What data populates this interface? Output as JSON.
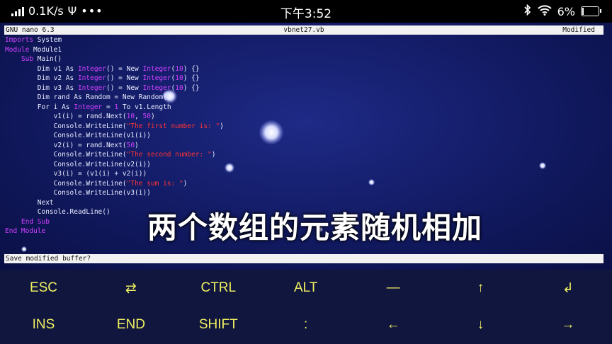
{
  "status_bar": {
    "speed": "0.1K/s",
    "time": "下午3:52",
    "battery": "6%",
    "battery_level": 0.06
  },
  "editor": {
    "app_version": "GNU nano 6.3",
    "filename": "vbnet27.vb",
    "state": "Modified",
    "prompt": "Save modified buffer?"
  },
  "code_lines": [
    [
      {
        "t": "Imports",
        "c": "kw"
      },
      {
        "t": " System",
        "c": "plain"
      }
    ],
    [
      {
        "t": "Module",
        "c": "kw"
      },
      {
        "t": " Module1",
        "c": "plain"
      }
    ],
    [
      {
        "t": "    ",
        "c": "plain"
      },
      {
        "t": "Sub",
        "c": "kw"
      },
      {
        "t": " Main()",
        "c": "plain"
      }
    ],
    [
      {
        "t": "        Dim v1 As ",
        "c": "plain"
      },
      {
        "t": "Integer",
        "c": "kw"
      },
      {
        "t": "() = New ",
        "c": "plain"
      },
      {
        "t": "Integer",
        "c": "kw"
      },
      {
        "t": "(",
        "c": "plain"
      },
      {
        "t": "10",
        "c": "num"
      },
      {
        "t": ") {}",
        "c": "plain"
      }
    ],
    [
      {
        "t": "        Dim v2 As ",
        "c": "plain"
      },
      {
        "t": "Integer",
        "c": "kw"
      },
      {
        "t": "() = New ",
        "c": "plain"
      },
      {
        "t": "Integer",
        "c": "kw"
      },
      {
        "t": "(",
        "c": "plain"
      },
      {
        "t": "10",
        "c": "num"
      },
      {
        "t": ") {}",
        "c": "plain"
      }
    ],
    [
      {
        "t": "        Dim v3 As ",
        "c": "plain"
      },
      {
        "t": "Integer",
        "c": "kw"
      },
      {
        "t": "() = New ",
        "c": "plain"
      },
      {
        "t": "Integer",
        "c": "kw"
      },
      {
        "t": "(",
        "c": "plain"
      },
      {
        "t": "10",
        "c": "num"
      },
      {
        "t": ") {}",
        "c": "plain"
      }
    ],
    [
      {
        "t": "        Dim rand As Random = New Random()",
        "c": "plain"
      }
    ],
    [
      {
        "t": "        For i As ",
        "c": "plain"
      },
      {
        "t": "Integer",
        "c": "kw"
      },
      {
        "t": " = ",
        "c": "plain"
      },
      {
        "t": "1",
        "c": "num"
      },
      {
        "t": " To v1.Length",
        "c": "plain"
      }
    ],
    [
      {
        "t": "            v1(i) = rand.Next(",
        "c": "plain"
      },
      {
        "t": "10",
        "c": "num"
      },
      {
        "t": ", ",
        "c": "plain"
      },
      {
        "t": "50",
        "c": "num"
      },
      {
        "t": ")",
        "c": "plain"
      }
    ],
    [
      {
        "t": "            Console.WriteLine(",
        "c": "plain"
      },
      {
        "t": "\"The first number is: \"",
        "c": "str"
      },
      {
        "t": ")",
        "c": "plain"
      }
    ],
    [
      {
        "t": "            Console.WriteLine(v1(i))",
        "c": "plain"
      }
    ],
    [
      {
        "t": "            v2(i) = rand.Next(",
        "c": "plain"
      },
      {
        "t": "50",
        "c": "num"
      },
      {
        "t": ")",
        "c": "plain"
      }
    ],
    [
      {
        "t": "            Console.WriteLine(",
        "c": "plain"
      },
      {
        "t": "\"The second number: \"",
        "c": "str"
      },
      {
        "t": ")",
        "c": "plain"
      }
    ],
    [
      {
        "t": "            Console.WriteLine(v2(i))",
        "c": "plain"
      }
    ],
    [
      {
        "t": "            v3(i) = (v1(i) + v2(i))",
        "c": "plain"
      }
    ],
    [
      {
        "t": "            Console.WriteLine(",
        "c": "plain"
      },
      {
        "t": "\"The sum is: \"",
        "c": "str"
      },
      {
        "t": ")",
        "c": "plain"
      }
    ],
    [
      {
        "t": "            Console.WriteLine(v3(i))",
        "c": "plain"
      }
    ],
    [
      {
        "t": "        Next",
        "c": "plain"
      }
    ],
    [
      {
        "t": "        Console.ReadLine()",
        "c": "plain"
      }
    ],
    [
      {
        "t": "    ",
        "c": "plain"
      },
      {
        "t": "End Sub",
        "c": "kw"
      }
    ],
    [
      {
        "t": "End Module",
        "c": "kw"
      }
    ]
  ],
  "overlay_caption": "两个数组的元素随机相加",
  "extra_keys": {
    "row1": [
      "ESC",
      "⇄",
      "CTRL",
      "ALT",
      "—",
      "↑",
      "↲"
    ],
    "row2": [
      "INS",
      "END",
      "SHIFT",
      ":",
      "←",
      "↓",
      "→"
    ]
  },
  "colors": {
    "keyword": "#d040ff",
    "string": "#ff3333",
    "key_text": "#f0f060",
    "terminal_bg": "#121a62"
  }
}
